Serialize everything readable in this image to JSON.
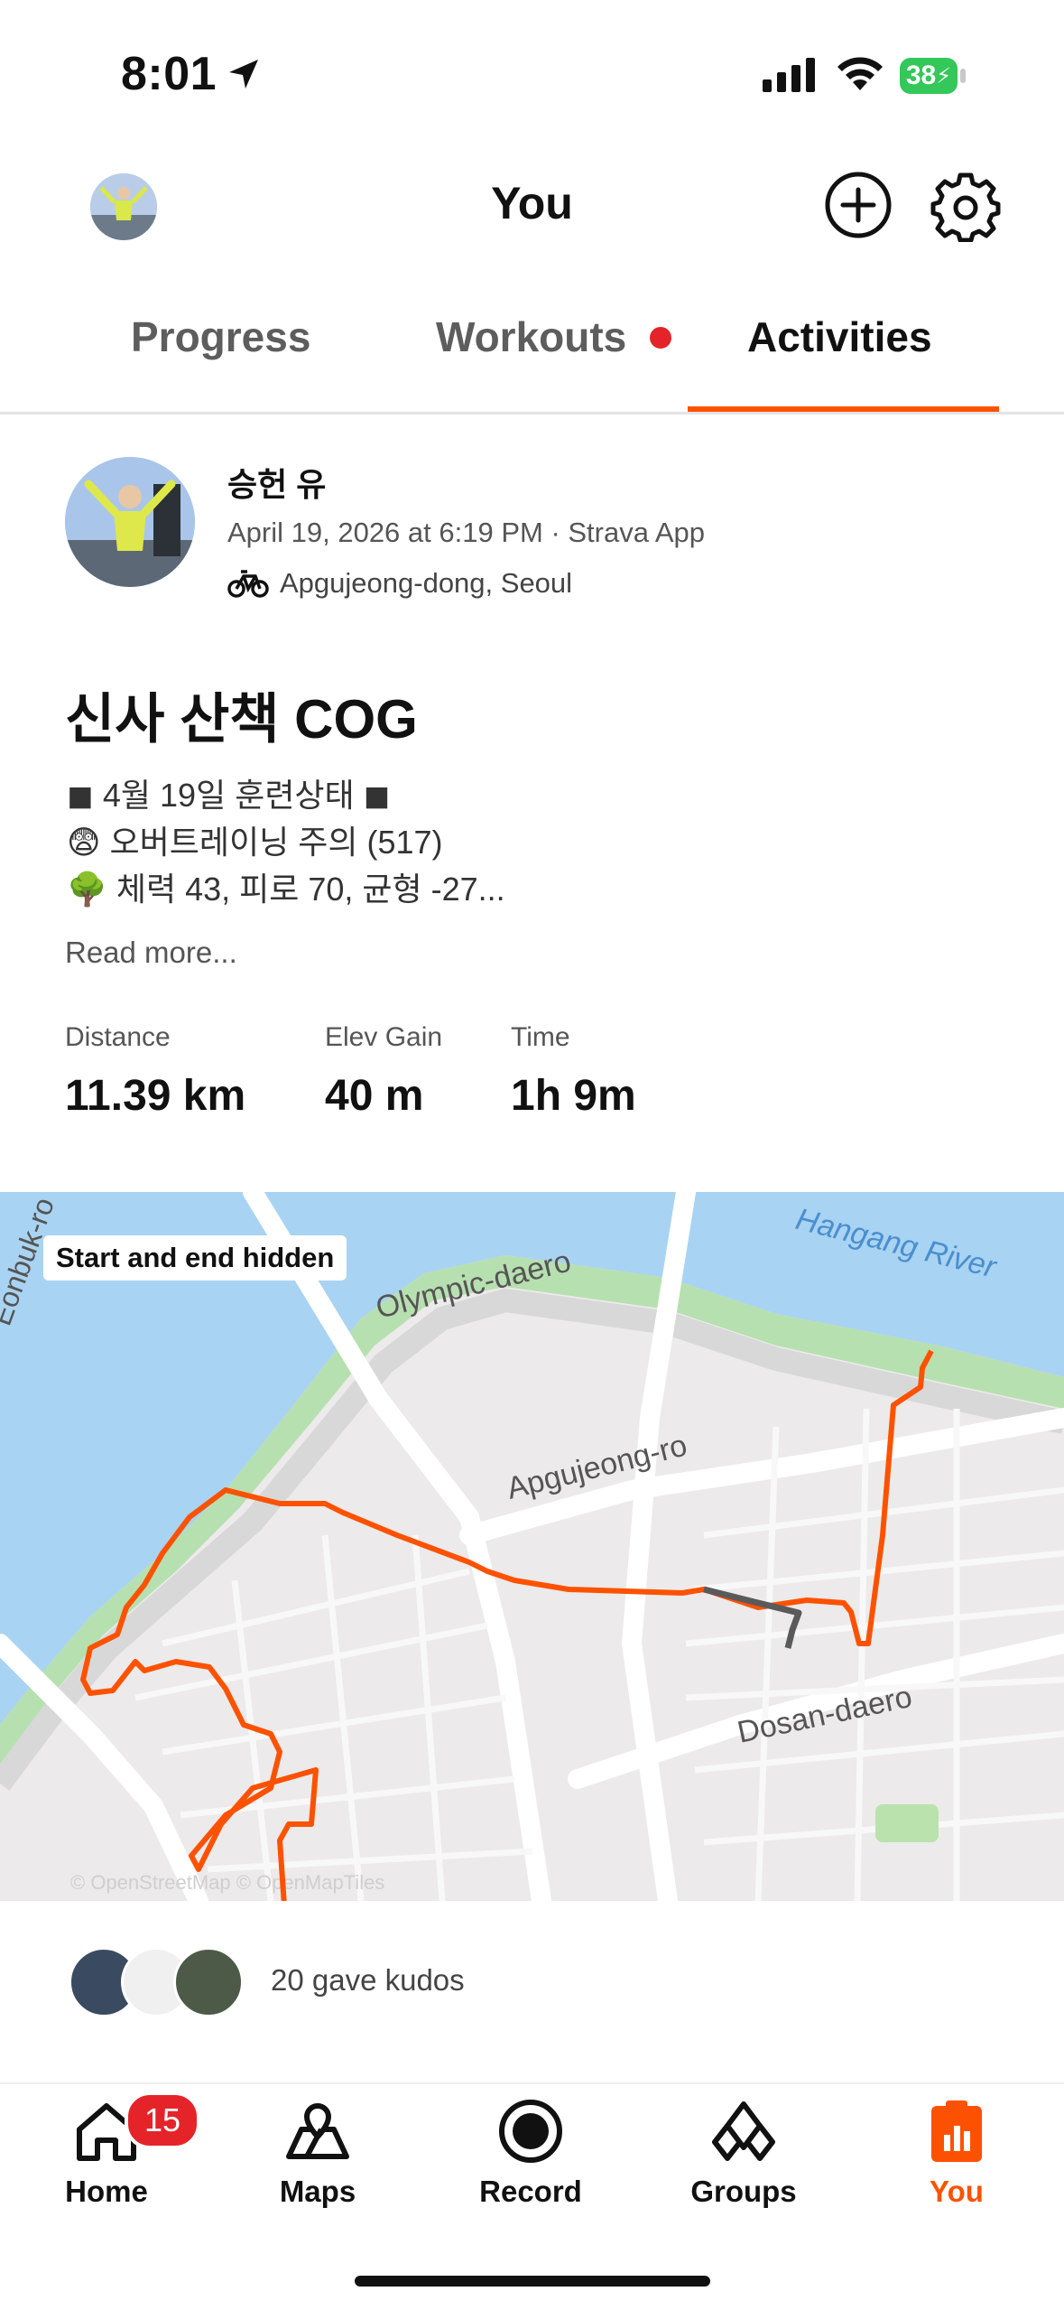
{
  "status": {
    "time": "8:01",
    "battery": "38"
  },
  "header": {
    "title": "You"
  },
  "tabs": [
    {
      "label": "Progress"
    },
    {
      "label": "Workouts"
    },
    {
      "label": "Activities"
    }
  ],
  "activity": {
    "athlete": "승헌 유",
    "meta": "April 19, 2026 at 6:19 PM · Strava App",
    "location": "Apgujeong-dong, Seoul",
    "title": "신사 산책 COG",
    "description": [
      "◼︎ 4월 19일 훈련상태 ◼︎",
      "😨 오버트레이닝 주의 (517)",
      "🌳 체력 43, 피로 70, 균형 -27..."
    ],
    "read_more": "Read more...",
    "stats": [
      {
        "label": "Distance",
        "value": "11.39 km"
      },
      {
        "label": "Elev Gain",
        "value": "40 m"
      },
      {
        "label": "Time",
        "value": "1h 9m"
      }
    ]
  },
  "map": {
    "badge": "Start and end hidden",
    "labels": {
      "river": "Hangang River",
      "road1": "Olympic-daero",
      "road2": "Apgujeong-ro",
      "road3": "Dosan-daero",
      "road4": "Eonbuk-ro",
      "attribution": "© OpenStreetMap © OpenMapTiles"
    },
    "route_color": "#fc5200"
  },
  "kudos": {
    "text": "20 gave kudos"
  },
  "nav": {
    "home": "Home",
    "home_badge": "15",
    "maps": "Maps",
    "record": "Record",
    "groups": "Groups",
    "you": "You"
  },
  "colors": {
    "accent": "#fc5200",
    "alert": "#e5242a"
  }
}
